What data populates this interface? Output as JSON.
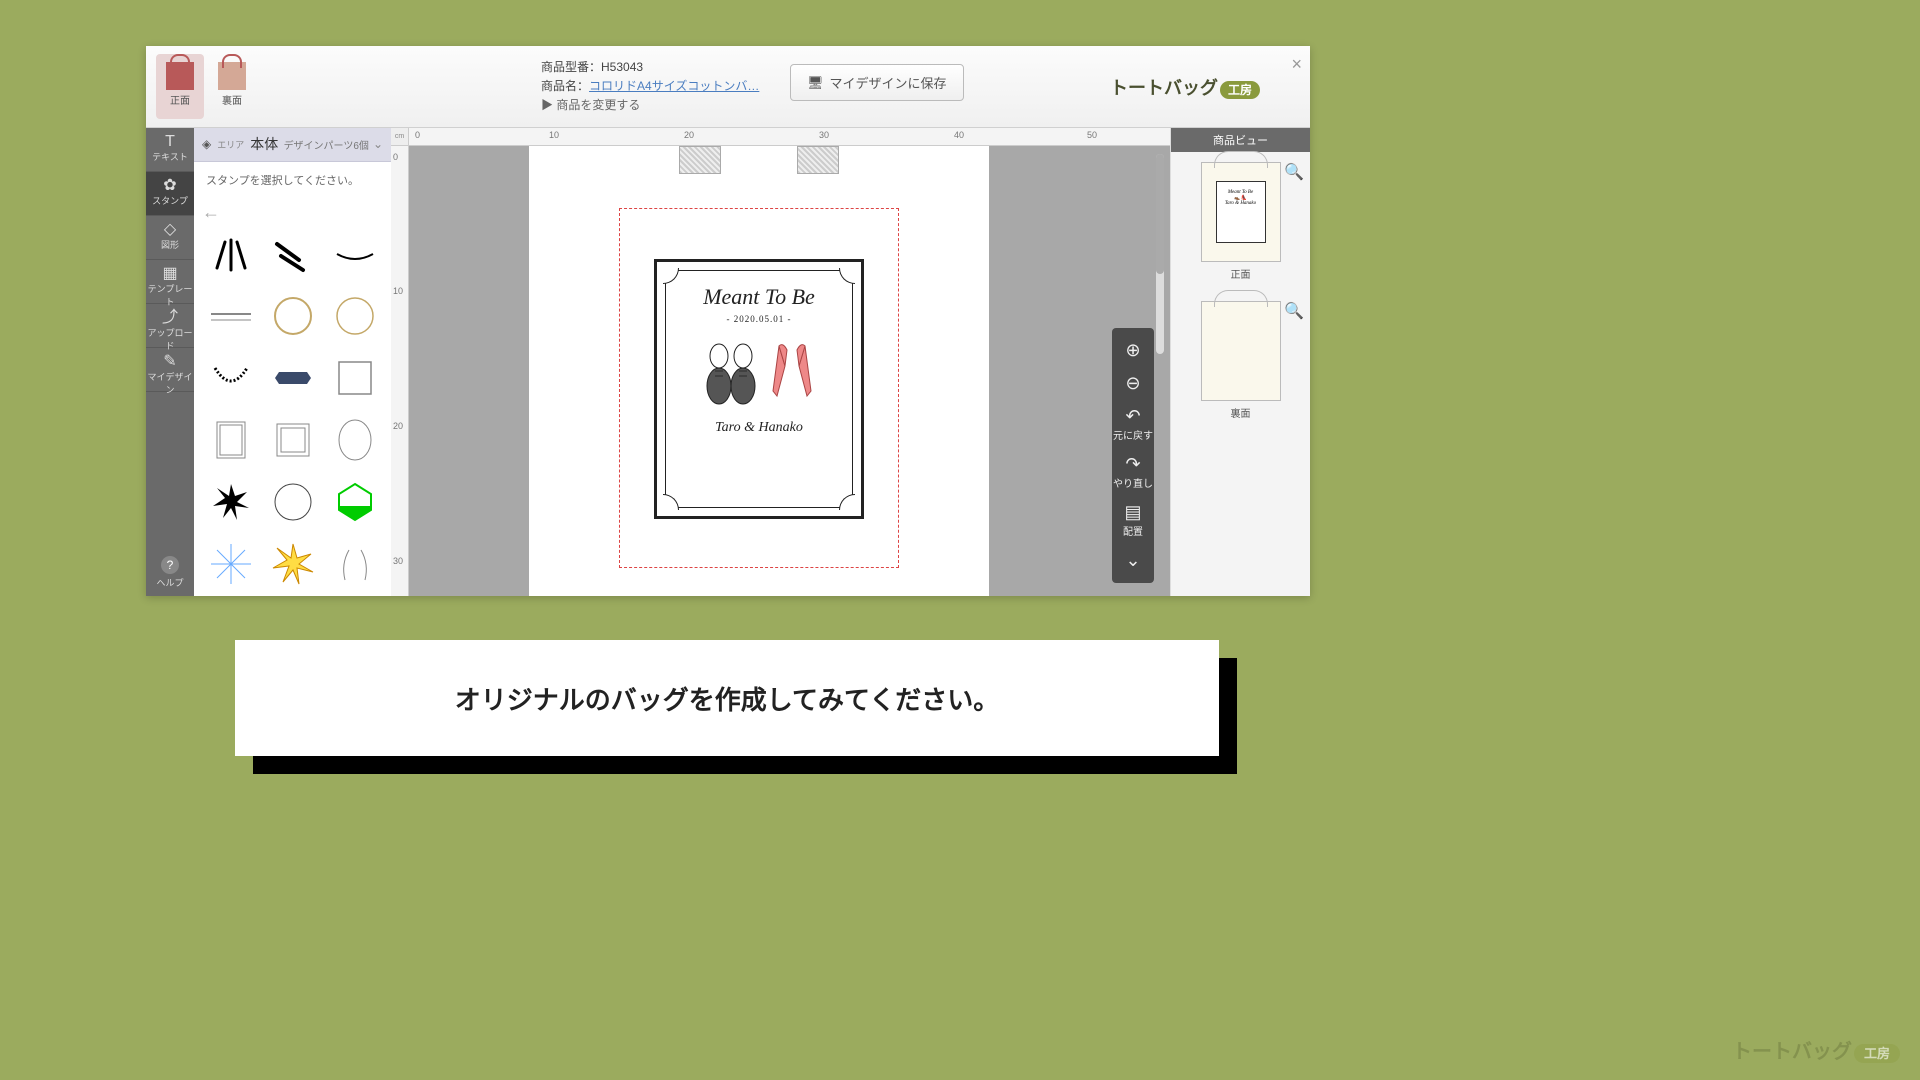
{
  "header": {
    "tabs": {
      "front": "正面",
      "back": "裏面"
    },
    "product_code_label": "商品型番：",
    "product_code": "H53043",
    "product_name_label": "商品名：",
    "product_name": "コロリドA4サイズコットンバ…",
    "change_product": "▶ 商品を変更する",
    "save_button": "マイデザインに保存",
    "logo_main": "トートバッグ",
    "logo_badge": "工房",
    "close": "×"
  },
  "area": {
    "icon_label": "エリア",
    "title": "本体",
    "parts_count": "デザインパーツ6個"
  },
  "tools": {
    "text": "テキスト",
    "stamp": "スタンプ",
    "shape": "図形",
    "template": "テンプレート",
    "upload": "アップロード",
    "mydesign": "マイデザイン",
    "help": "ヘルプ"
  },
  "stamp_panel": {
    "instruction": "スタンプを選択してください。"
  },
  "ruler": {
    "unit": "cm",
    "h": [
      "0",
      "10",
      "20",
      "30",
      "40",
      "50"
    ],
    "v": [
      "0",
      "10",
      "20",
      "30"
    ]
  },
  "design": {
    "title": "Meant To Be",
    "date": "- 2020.05.01 -",
    "names": "Taro & Hanako"
  },
  "zoom": {
    "undo": "元に戻す",
    "redo": "やり直し",
    "align": "配置"
  },
  "right": {
    "header": "商品ビュー",
    "front": "正面",
    "back": "裏面"
  },
  "caption": "オリジナルのバッグを作成してみてください。",
  "corner_logo": {
    "main": "トートバッグ",
    "badge": "工房"
  }
}
